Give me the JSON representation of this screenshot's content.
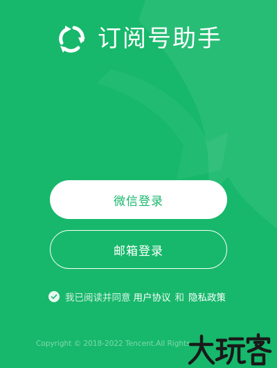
{
  "app": {
    "title": "订阅号助手",
    "logo_icon": "subscription-assistant-logo"
  },
  "buttons": {
    "wechat_login": "微信登录",
    "email_login": "邮箱登录"
  },
  "agreement": {
    "checked": true,
    "prefix": "我已阅读并同意",
    "user_agreement": "用户协议",
    "and": "和",
    "privacy_policy": "隐私政策"
  },
  "footer": {
    "copyright": "Copyright © 2018-2022 Tencent.All Rights"
  },
  "watermark": {
    "text": "大玩客"
  },
  "colors": {
    "background": "#17b86b",
    "button_text": "#17b86b",
    "white": "#ffffff"
  }
}
